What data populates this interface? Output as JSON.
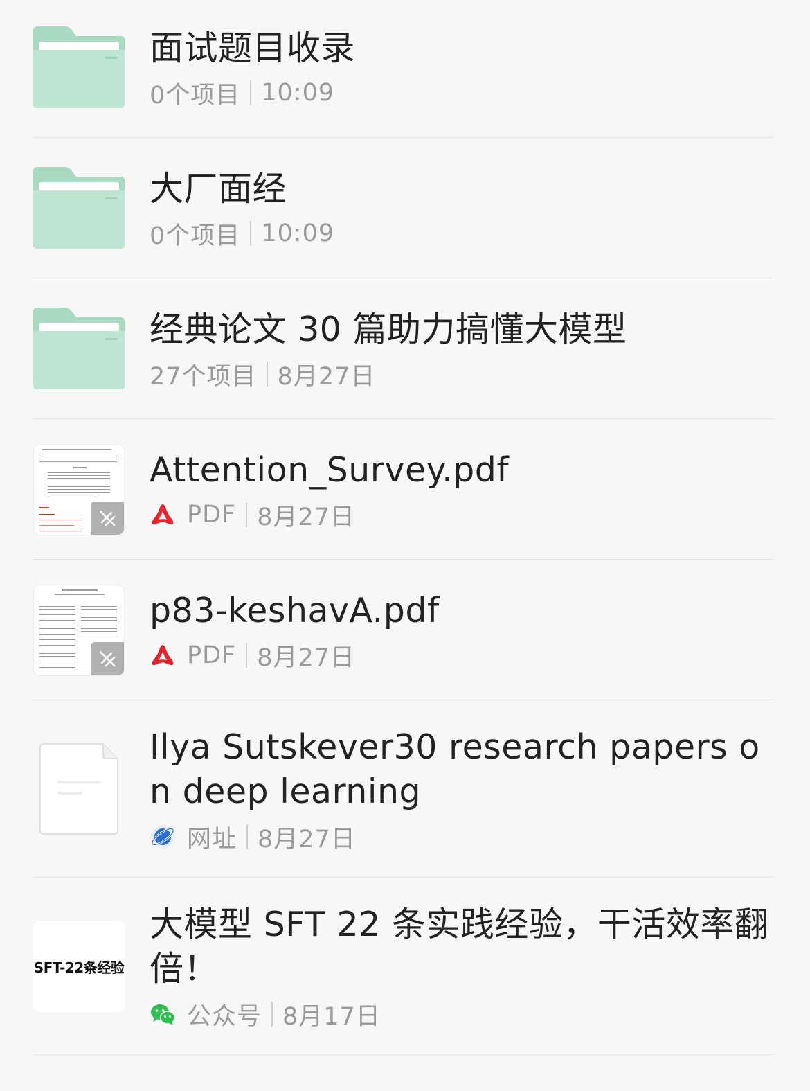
{
  "items": [
    {
      "type": "folder",
      "title": "面试题目收录",
      "count": "0个项目",
      "date": "10:09"
    },
    {
      "type": "folder",
      "title": "大厂面经",
      "count": "0个项目",
      "date": "10:09"
    },
    {
      "type": "folder",
      "title": "经典论文 30 篇助力搞懂大模型",
      "count": "27个项目",
      "date": "8月27日"
    },
    {
      "type": "pdf",
      "title": "Attention_Survey.pdf",
      "source": "PDF",
      "source_icon": "pdf-icon",
      "date": "8月27日"
    },
    {
      "type": "pdf",
      "title": "p83-keshavA.pdf",
      "source": "PDF",
      "source_icon": "pdf-icon",
      "date": "8月27日"
    },
    {
      "type": "link",
      "title": "Ilya Sutskever30 research papers on deep learning",
      "source": "网址",
      "source_icon": "browser-planet-icon",
      "date": "8月27日"
    },
    {
      "type": "article",
      "title": "大模型 SFT 22 条实践经验，干活效率翻倍！",
      "thumb_text": "SFT-22条经验",
      "source": "公众号",
      "source_icon": "wechat-icon",
      "date": "8月17日"
    }
  ],
  "colors": {
    "folder": "#bfe6d3",
    "folder_tab": "#a9dbc2",
    "pdf_red": "#e8232d",
    "wechat_green": "#2fbf4f",
    "browser_blue": "#2b6fd6"
  }
}
